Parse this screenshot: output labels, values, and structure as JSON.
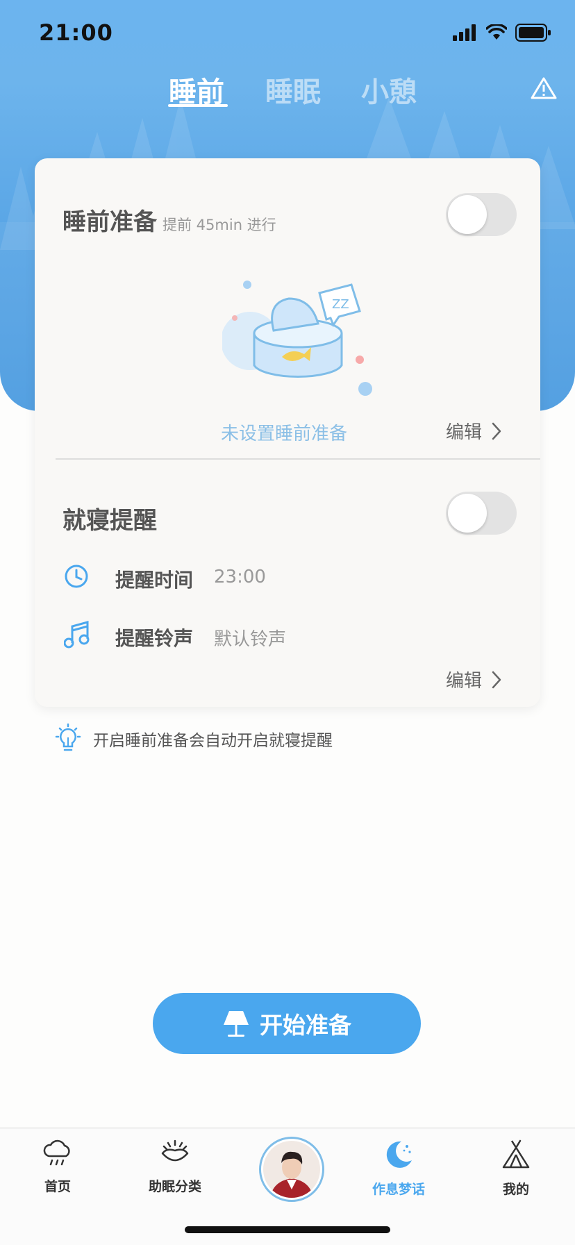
{
  "status_bar": {
    "time": "21:00"
  },
  "top_tabs": [
    {
      "label": "睡前",
      "active": true
    },
    {
      "label": "睡眠",
      "active": false
    },
    {
      "label": "小憩",
      "active": false
    }
  ],
  "header_icon": "warning-triangle-icon",
  "pre_sleep": {
    "title": "睡前准备",
    "subtitle": "提前 45min 进行",
    "enabled": false,
    "empty_text": "未设置睡前准备",
    "edit_label": "编辑",
    "illustration_text": "ZZ"
  },
  "bedtime_reminder": {
    "title": "就寝提醒",
    "enabled": false,
    "time_label": "提醒时间",
    "time_value": "23:00",
    "ringtone_label": "提醒铃声",
    "ringtone_value": "默认铃声",
    "edit_label": "编辑"
  },
  "tip": "开启睡前准备会自动开启就寝提醒",
  "start_button": "开始准备",
  "bottom_nav": [
    {
      "label": "首页",
      "icon": "cloud-rain-icon",
      "active": false
    },
    {
      "label": "助眠分类",
      "icon": "bowl-icon",
      "active": false
    },
    {
      "label": "",
      "icon": "avatar",
      "active": false
    },
    {
      "label": "作息梦话",
      "icon": "moon-icon",
      "active": true
    },
    {
      "label": "我的",
      "icon": "tent-icon",
      "active": false
    }
  ],
  "colors": {
    "accent": "#4aa7ee",
    "hero": "#5aa6e6",
    "toggle_off": "#e3e3e3"
  }
}
